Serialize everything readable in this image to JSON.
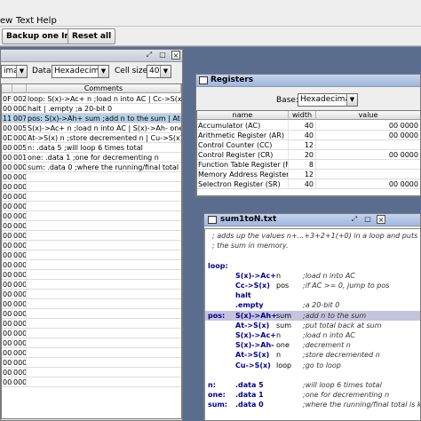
{
  "menu": [
    "ew",
    "Text",
    "Help"
  ],
  "toolbar": {
    "backup": "Backup one Instr",
    "reset": "Reset all"
  },
  "ram": {
    "data_label": "Data:",
    "data_format": "Hexadecimal",
    "addr_format": "imal",
    "cellsize_label": "Cell size:",
    "cellsize": "40",
    "comments_header": "Comments",
    "rows": [
      {
        "a": "0F",
        "b": "002",
        "c": "loop: S(x)->Ac+ n ;load n into AC | Cc->S(x) pos ..."
      },
      {
        "a": "00",
        "b": "000",
        "c": "halt | .empty ;a 20-bit 0"
      },
      {
        "a": "11",
        "b": "007",
        "c": "pos: S(x)->Ah+ sum ;add n to the sum | At->S(x)..."
      },
      {
        "a": "00",
        "b": "005",
        "c": "S(x)->Ac+ n ;load n into AC | S(x)->Ah- one ;decr..."
      },
      {
        "a": "0D",
        "b": "000",
        "c": "At->S(x) n ;store decremented n | Cu->S(x) loop..."
      },
      {
        "a": "00",
        "b": "005",
        "c": "n: .data 5 ;will loop 6 times total"
      },
      {
        "a": "00",
        "b": "001",
        "c": "one: .data 1 ;one for decrementing n"
      },
      {
        "a": "00",
        "b": "000",
        "c": "sum: .data 0 ;where the running/final total is kept"
      },
      {
        "a": "00",
        "b": "000",
        "c": ""
      },
      {
        "a": "00",
        "b": "000",
        "c": ""
      },
      {
        "a": "00",
        "b": "000",
        "c": ""
      },
      {
        "a": "00",
        "b": "000",
        "c": ""
      },
      {
        "a": "00",
        "b": "000",
        "c": ""
      },
      {
        "a": "00",
        "b": "000",
        "c": ""
      },
      {
        "a": "00",
        "b": "000",
        "c": ""
      },
      {
        "a": "00",
        "b": "000",
        "c": ""
      },
      {
        "a": "00",
        "b": "000",
        "c": ""
      },
      {
        "a": "00",
        "b": "000",
        "c": ""
      },
      {
        "a": "00",
        "b": "000",
        "c": ""
      },
      {
        "a": "00",
        "b": "000",
        "c": ""
      },
      {
        "a": "00",
        "b": "000",
        "c": ""
      },
      {
        "a": "00",
        "b": "000",
        "c": ""
      },
      {
        "a": "00",
        "b": "000",
        "c": ""
      },
      {
        "a": "00",
        "b": "000",
        "c": ""
      },
      {
        "a": "00",
        "b": "000",
        "c": ""
      },
      {
        "a": "00",
        "b": "000",
        "c": ""
      },
      {
        "a": "00",
        "b": "000",
        "c": ""
      },
      {
        "a": "00",
        "b": "000",
        "c": ""
      },
      {
        "a": "00",
        "b": "000",
        "c": ""
      },
      {
        "a": "00",
        "b": "000",
        "c": ""
      }
    ]
  },
  "registers": {
    "title": "Registers",
    "base_label": "Base:",
    "base": "Hexadecimal",
    "headers": [
      "name",
      "width",
      "value"
    ],
    "rows": [
      {
        "name": "Accumulator (AC)",
        "width": "40",
        "value": "00  0000"
      },
      {
        "name": "Arithmetic Register (AR)",
        "width": "40",
        "value": "00  0000"
      },
      {
        "name": "Control Counter (CC)",
        "width": "12",
        "value": ""
      },
      {
        "name": "Control Register (CR)",
        "width": "20",
        "value": "00  0000"
      },
      {
        "name": "Function Table Register (F...",
        "width": "8",
        "value": ""
      },
      {
        "name": "Memory Address Register ...",
        "width": "12",
        "value": ""
      },
      {
        "name": "Selectron Register (SR)",
        "width": "40",
        "value": "00  0000"
      }
    ]
  },
  "editor": {
    "title": "sum1toN.txt",
    "lines": [
      {
        "label": "",
        "op": "",
        "arg": "",
        "cm": "; adds up the values n+...+3+2+1(+0) in a loop and puts"
      },
      {
        "label": "",
        "op": "",
        "arg": "",
        "cm": "; the sum in memory."
      },
      {
        "label": "",
        "op": "",
        "arg": "",
        "cm": ""
      },
      {
        "label": "loop:",
        "op": "",
        "arg": "",
        "cm": ""
      },
      {
        "label": "",
        "op": "S(x)->Ac+",
        "arg": "n",
        "cm": ";load n into AC"
      },
      {
        "label": "",
        "op": "Cc->S(x)",
        "arg": "pos",
        "cm": ";if AC >= 0, jump to pos"
      },
      {
        "label": "",
        "op": "halt",
        "arg": "",
        "cm": ""
      },
      {
        "label": "",
        "op": ".empty",
        "arg": "",
        "cm": ";a 20-bit 0"
      },
      {
        "label": "pos:",
        "op": "S(x)->Ah+",
        "arg": "sum",
        "cm": ";add n to the sum"
      },
      {
        "label": "",
        "op": "At->S(x)",
        "arg": "sum",
        "cm": ";put total back at sum"
      },
      {
        "label": "",
        "op": "S(x)->Ac+",
        "arg": "n",
        "cm": ";load n into AC"
      },
      {
        "label": "",
        "op": "S(x)->Ah-",
        "arg": "one",
        "cm": ";decrement n"
      },
      {
        "label": "",
        "op": "At->S(x)",
        "arg": "n",
        "cm": ";store decremented n"
      },
      {
        "label": "",
        "op": "Cu->S(x)",
        "arg": "loop",
        "cm": ";go to loop"
      },
      {
        "label": "",
        "op": "",
        "arg": "",
        "cm": ""
      },
      {
        "label": "n:",
        "op": ".data 5",
        "arg": "",
        "cm": ";will loop 6 times total"
      },
      {
        "label": "one:",
        "op": ".data 1",
        "arg": "",
        "cm": ";one for decrementing n"
      },
      {
        "label": "sum:",
        "op": ".data 0",
        "arg": "",
        "cm": ";where the running/final total is kept"
      }
    ],
    "highlight_line": 8
  }
}
